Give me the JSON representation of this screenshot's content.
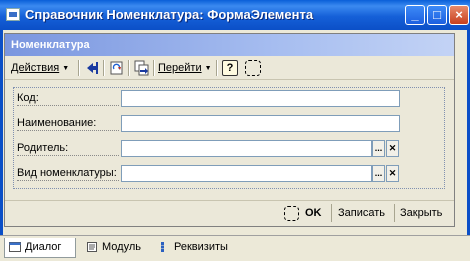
{
  "window": {
    "title": "Справочник Номенклатура: ФормаЭлемента",
    "minimize_glyph": "_",
    "maximize_glyph": "□",
    "close_glyph": "×"
  },
  "form": {
    "title": "Номенклатура"
  },
  "toolbar": {
    "actions_label": "Действия",
    "goto_label": "Перейти",
    "help_glyph": "?",
    "menu_arrow": "▼"
  },
  "fields": [
    {
      "label": "Код:",
      "value": ""
    },
    {
      "label": "Наименование:",
      "value": ""
    },
    {
      "label": "Родитель:",
      "value": "",
      "select_glyph": "...",
      "clear_glyph": "✕"
    },
    {
      "label": "Вид номенклатуры:",
      "value": "",
      "select_glyph": "...",
      "clear_glyph": "✕"
    }
  ],
  "buttons": {
    "ok_label": "OK",
    "save_label": "Записать",
    "close_label": "Закрыть"
  },
  "tabs": [
    {
      "label": "Диалог",
      "active": true
    },
    {
      "label": "Модуль",
      "active": false
    },
    {
      "label": "Реквизиты",
      "active": false
    }
  ],
  "colors": {
    "titlebar": "#0b4fc7",
    "form_title_gradient_start": "#7a96df",
    "background": "#ece9d8"
  }
}
